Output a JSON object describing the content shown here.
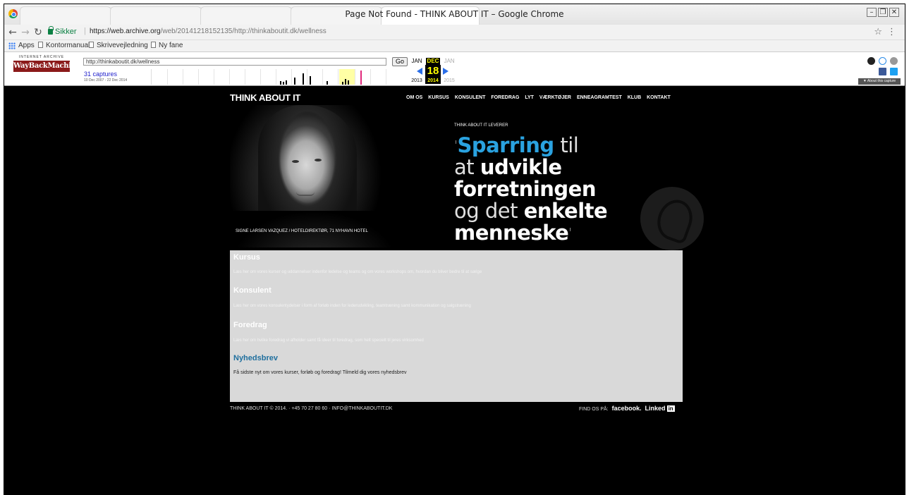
{
  "window": {
    "title": "Page Not Found - THINK ABOUT IT – Google Chrome"
  },
  "toolbar": {
    "secure_label": "Sikker",
    "url_host": "https://web.archive.org",
    "url_path": "/web/20141218152135/http://thinkaboutit.dk/wellness"
  },
  "bookmarks": [
    "Apps",
    "Kontormanual",
    "Skrivevejledning",
    "Ny fane"
  ],
  "wayback": {
    "logo_top": "INTERNET ARCHIVE",
    "logo_main": "WayBackMachine",
    "url_value": "http://thinkaboutit.dk/wellness",
    "go_label": "Go",
    "captures": "31 captures",
    "range": "10 Dec 2007 - 22 Dec 2014",
    "months": {
      "prev": "JAN",
      "current": "DEC",
      "next": "JAN"
    },
    "day": "18",
    "years": {
      "prev": "2013",
      "current": "2014",
      "next": "2015"
    },
    "about": "▼ About this capture"
  },
  "site": {
    "logo": "THINK ABOUT IT",
    "nav": [
      "OM OS",
      "KURSUS",
      "KONSULENT",
      "FOREDRAG",
      "LYT",
      "VÆRKTØJER",
      "ENNEAGRAMTEST",
      "KLUB",
      "KONTAKT"
    ],
    "caption": "SIGNE LARSEN VAZQUEZ  /  HOTELDIREKTØR, 71 NYHAVN HOTEL",
    "kicker": "THINK ABOUT IT LEVERER",
    "headline": {
      "open_quote": "'",
      "w1": "Sparring",
      "w2": " til",
      "w3": "at ",
      "w4": "udvikle forretningen",
      "w5": "og det ",
      "w6": "enkelte",
      "w7": "menneske",
      "close_quote": "'"
    },
    "sections": [
      {
        "title": "Kursus",
        "text": "Læs her om vores kurser og uddannelser indenfor ledelse og teams og om vores workshops om, hvordan du bliver bedre til at sælge"
      },
      {
        "title": "Konsulent",
        "text": "Læs her om vores konsulentydelser i form af forløb inden for lederudvikling, teamtræning samt kommunikation og salgstræning"
      },
      {
        "title": "Foredrag",
        "text": "Læs her om hvilke foredrag vi afholder samt få ideer til foredrag, som helt specielt til jeres virksomhed"
      }
    ],
    "newsletter": {
      "title": "Nyhedsbrev",
      "text": "Få sidste nyt om vores kurser, forløb og foredrag! Tilmeld dig vores nyhedsbrev"
    },
    "footer_left": "THINK ABOUT IT © 2014.  ·  +45 70 27 80 60  ·  INFO@THINKABOUTIT.DK",
    "footer_find": "FIND OS PÅ:",
    "footer_facebook": "facebook.",
    "footer_linked": "Linked",
    "footer_in": "in"
  },
  "colors": {
    "accent_blue": "#2aa2e0",
    "wayback_red": "#8b1a1a",
    "secure_green": "#0b8043"
  }
}
